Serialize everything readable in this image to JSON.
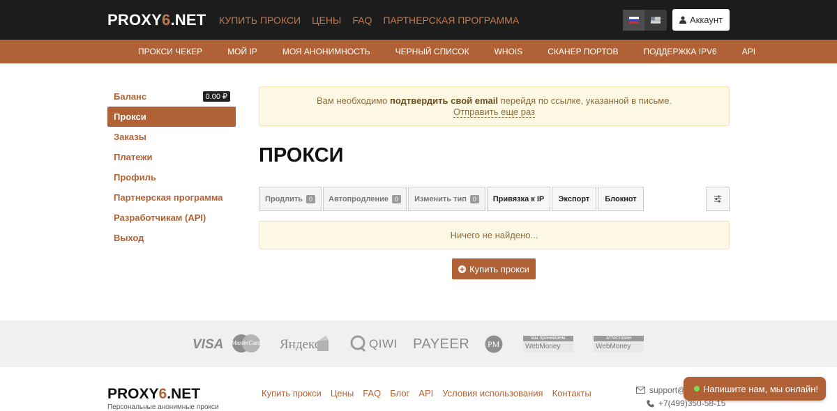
{
  "header": {
    "logo_prefix": "PROXY",
    "logo_six": "6",
    "logo_suffix": ".NET",
    "nav": [
      "КУПИТЬ ПРОКСИ",
      "ЦЕНЫ",
      "FAQ",
      "ПАРТНЕРСКАЯ ПРОГРАММА"
    ],
    "account_label": "Аккаунт",
    "accent_color": "#b06236"
  },
  "subnav": [
    "ПРОКСИ ЧЕКЕР",
    "МОЙ IP",
    "МОЯ АНОНИМНОСТЬ",
    "ЧЕРНЫЙ СПИСОК",
    "WHOIS",
    "СКАНЕР ПОРТОВ",
    "ПОДДЕРЖКА IPV6",
    "API"
  ],
  "sidebar": {
    "items": [
      {
        "label": "Баланс",
        "badge": "0.00 ₽"
      },
      {
        "label": "Прокси"
      },
      {
        "label": "Заказы"
      },
      {
        "label": "Платежи"
      },
      {
        "label": "Профиль"
      },
      {
        "label": "Партнерская программа"
      },
      {
        "label": "Разработчикам (API)"
      },
      {
        "label": "Выход"
      }
    ]
  },
  "alert": {
    "text_before": "Вам необходимо ",
    "text_bold": "подтвердить свой email",
    "text_after": " перейдя по ссылке, указанной в письме.",
    "link": "Отправить еще раз"
  },
  "main": {
    "title": "ПРОКСИ",
    "toolbar": [
      {
        "label": "Продлить",
        "count": "0"
      },
      {
        "label": "Автопродление",
        "count": "0"
      },
      {
        "label": "Изменить тип",
        "count": "0"
      },
      {
        "label": "Привязка к IP"
      },
      {
        "label": "Экспорт"
      },
      {
        "label": "Блокнот"
      }
    ],
    "empty_text": "Ничего не найдено...",
    "buy_label": "Купить прокси"
  },
  "payments": {
    "visa": "VISA",
    "mastercard": "MasterCard",
    "yandex": "Яндекс",
    "qiwi": "QIWI",
    "payeer": "PAYEER",
    "pm": "PM",
    "wm1_top": "мы принимаем",
    "wm1_bottom": "WebMoney",
    "wm2_top": "аттестован",
    "wm2_bottom": "WebMoney"
  },
  "footer": {
    "tagline": "Персональные анонимные прокси",
    "links": [
      "Купить прокси",
      "Цены",
      "FAQ",
      "Блог",
      "API",
      "Условия использования",
      "Контакты"
    ],
    "email": "support@",
    "phone": "+7(499)350-58-15",
    "chat_label": "Напишите нам, мы онлайн!"
  }
}
